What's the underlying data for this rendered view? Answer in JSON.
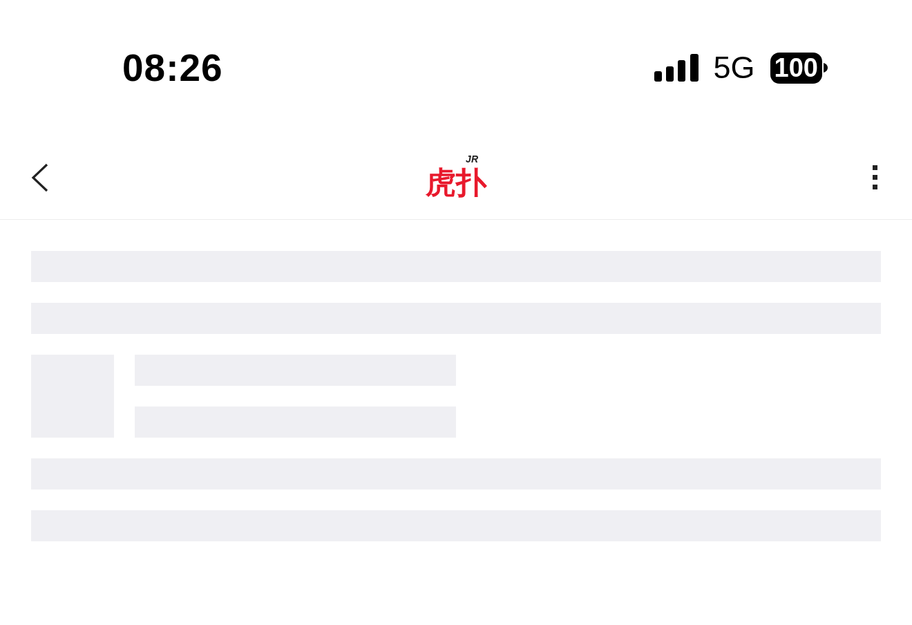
{
  "status_bar": {
    "time": "08:26",
    "network": "5G",
    "battery": "100"
  },
  "nav_bar": {
    "logo": {
      "text": "虎扑",
      "badge": "JR"
    }
  },
  "skeleton": [
    {
      "kind": "line"
    },
    {
      "kind": "line"
    },
    {
      "kind": "media"
    },
    {
      "kind": "line"
    },
    {
      "kind": "line"
    }
  ]
}
